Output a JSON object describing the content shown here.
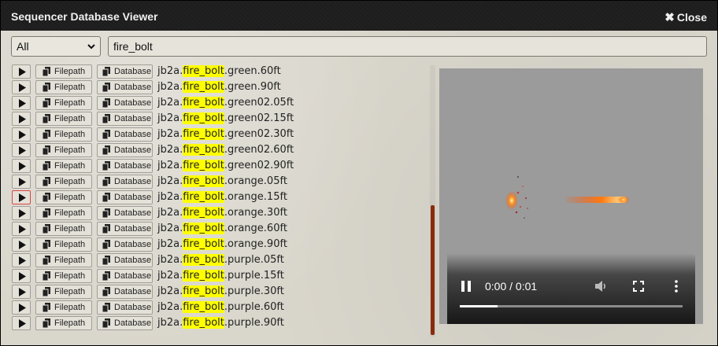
{
  "window": {
    "title": "Sequencer Database Viewer",
    "close_label": "Close"
  },
  "filter": {
    "selected": "All",
    "search_value": "fire_bolt"
  },
  "buttons": {
    "filepath": "Filepath",
    "database": "Database"
  },
  "rows": [
    {
      "prefix": "jb2a.",
      "match": "fire_bolt",
      "suffix": ".green.60ft"
    },
    {
      "prefix": "jb2a.",
      "match": "fire_bolt",
      "suffix": ".green.90ft"
    },
    {
      "prefix": "jb2a.",
      "match": "fire_bolt",
      "suffix": ".green02.05ft"
    },
    {
      "prefix": "jb2a.",
      "match": "fire_bolt",
      "suffix": ".green02.15ft"
    },
    {
      "prefix": "jb2a.",
      "match": "fire_bolt",
      "suffix": ".green02.30ft"
    },
    {
      "prefix": "jb2a.",
      "match": "fire_bolt",
      "suffix": ".green02.60ft"
    },
    {
      "prefix": "jb2a.",
      "match": "fire_bolt",
      "suffix": ".green02.90ft"
    },
    {
      "prefix": "jb2a.",
      "match": "fire_bolt",
      "suffix": ".orange.05ft"
    },
    {
      "prefix": "jb2a.",
      "match": "fire_bolt",
      "suffix": ".orange.15ft"
    },
    {
      "prefix": "jb2a.",
      "match": "fire_bolt",
      "suffix": ".orange.30ft"
    },
    {
      "prefix": "jb2a.",
      "match": "fire_bolt",
      "suffix": ".orange.60ft"
    },
    {
      "prefix": "jb2a.",
      "match": "fire_bolt",
      "suffix": ".orange.90ft"
    },
    {
      "prefix": "jb2a.",
      "match": "fire_bolt",
      "suffix": ".purple.05ft"
    },
    {
      "prefix": "jb2a.",
      "match": "fire_bolt",
      "suffix": ".purple.15ft"
    },
    {
      "prefix": "jb2a.",
      "match": "fire_bolt",
      "suffix": ".purple.30ft"
    },
    {
      "prefix": "jb2a.",
      "match": "fire_bolt",
      "suffix": ".purple.60ft"
    },
    {
      "prefix": "jb2a.",
      "match": "fire_bolt",
      "suffix": ".purple.90ft"
    }
  ],
  "selected_row": 8,
  "video": {
    "time": "0:00 / 0:01",
    "progress": 0.17
  },
  "colors": {
    "highlight": "#ffff00",
    "accent": "#8a2a0c",
    "titlebar": "#1d1d1d"
  }
}
